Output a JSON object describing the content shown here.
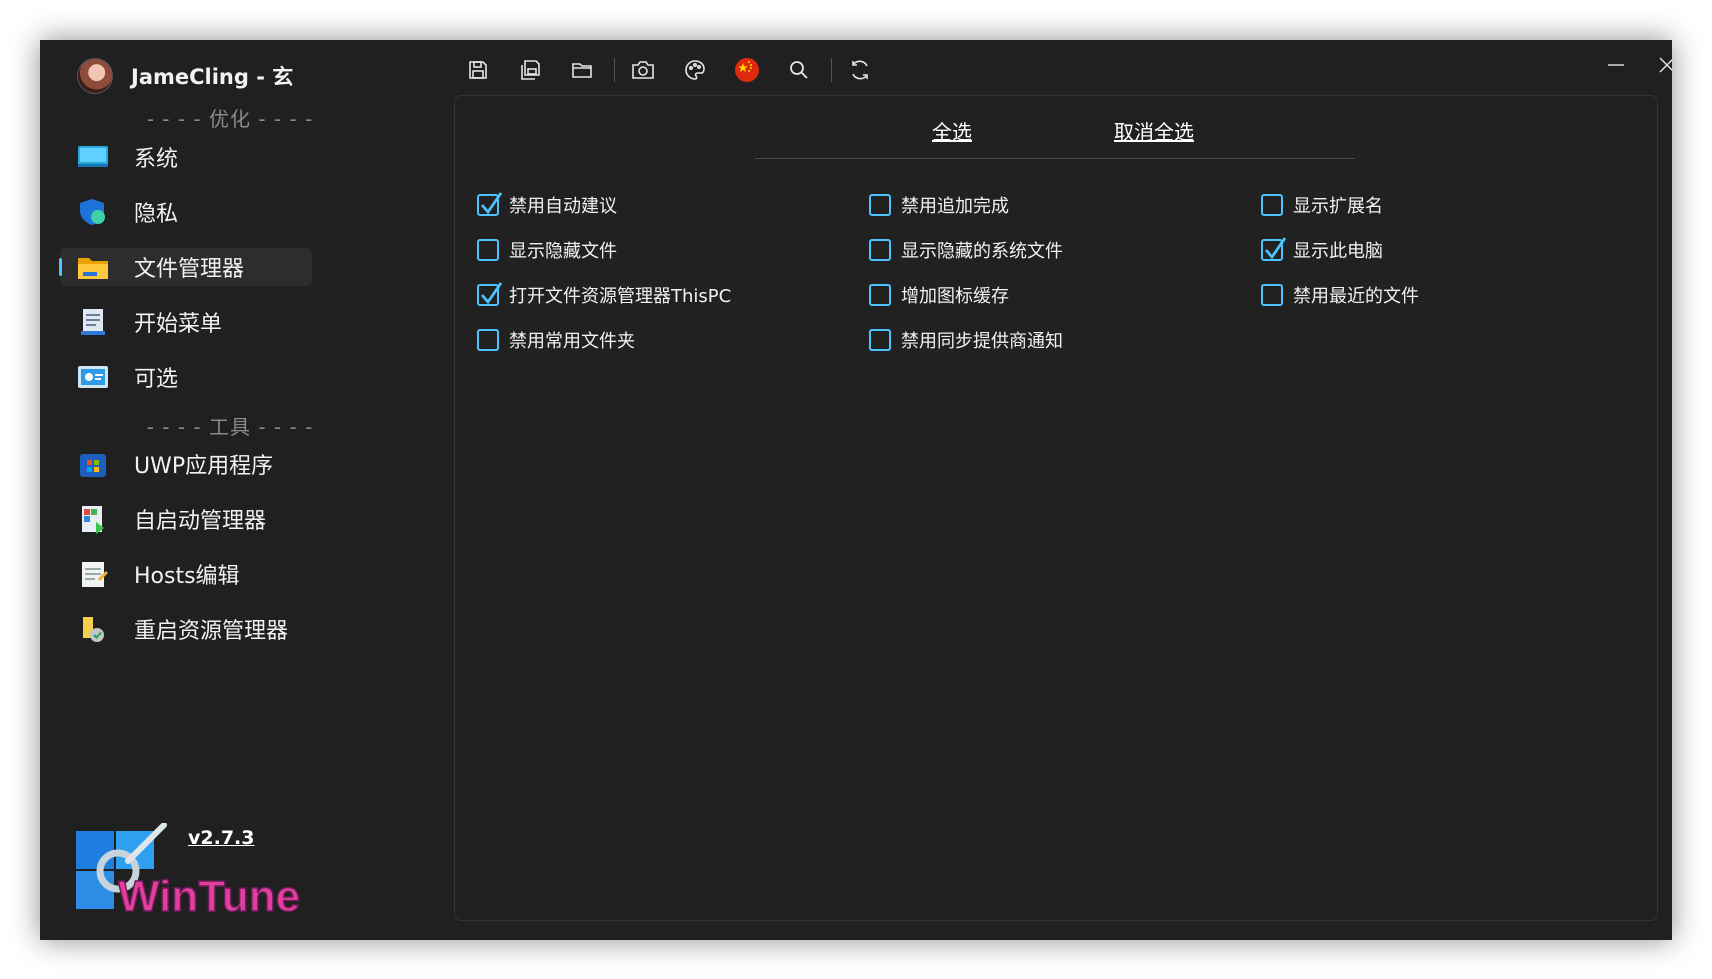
{
  "profile": {
    "name": "JameCling - 玄"
  },
  "sections": {
    "optimize": "- - - - 优化 - - - -",
    "tools": "- - - - 工具 - - - -"
  },
  "nav": [
    {
      "label": "系统",
      "icon": "system-monitor-icon",
      "selected": false
    },
    {
      "label": "隐私",
      "icon": "privacy-shield-icon",
      "selected": false
    },
    {
      "label": "文件管理器",
      "icon": "folder-icon",
      "selected": true
    },
    {
      "label": "开始菜单",
      "icon": "start-menu-icon",
      "selected": false
    },
    {
      "label": "可选",
      "icon": "optional-features-icon",
      "selected": false
    },
    {
      "label": "UWP应用程序",
      "icon": "store-app-icon",
      "selected": false
    },
    {
      "label": "自启动管理器",
      "icon": "startup-manager-icon",
      "selected": false
    },
    {
      "label": "Hosts编辑",
      "icon": "hosts-notepad-icon",
      "selected": false
    },
    {
      "label": "重启资源管理器",
      "icon": "restart-explorer-icon",
      "selected": false
    }
  ],
  "version": "v2.7.3",
  "logo_text": "WinTune",
  "toolbar": [
    "save-icon",
    "save-all-icon",
    "open-folder-icon",
    "camera-icon",
    "palette-icon",
    "china-flag-icon",
    "search-icon",
    "refresh-icon"
  ],
  "tabs": {
    "select_all": "全选",
    "deselect_all": "取消全选"
  },
  "options": [
    {
      "label": "禁用自动建议",
      "checked": true
    },
    {
      "label": "禁用追加完成",
      "checked": false
    },
    {
      "label": "显示扩展名",
      "checked": false
    },
    {
      "label": "显示隐藏文件",
      "checked": false
    },
    {
      "label": "显示隐藏的系统文件",
      "checked": false
    },
    {
      "label": "显示此电脑",
      "checked": true
    },
    {
      "label": "打开文件资源管理器ThisPC",
      "checked": true
    },
    {
      "label": "增加图标缓存",
      "checked": false
    },
    {
      "label": "禁用最近的文件",
      "checked": false
    },
    {
      "label": "禁用常用文件夹",
      "checked": false
    },
    {
      "label": "禁用同步提供商通知",
      "checked": false
    }
  ],
  "colors": {
    "accent": "#4cc2ff",
    "window_bg": "#202020",
    "panel_bg": "#212121"
  }
}
